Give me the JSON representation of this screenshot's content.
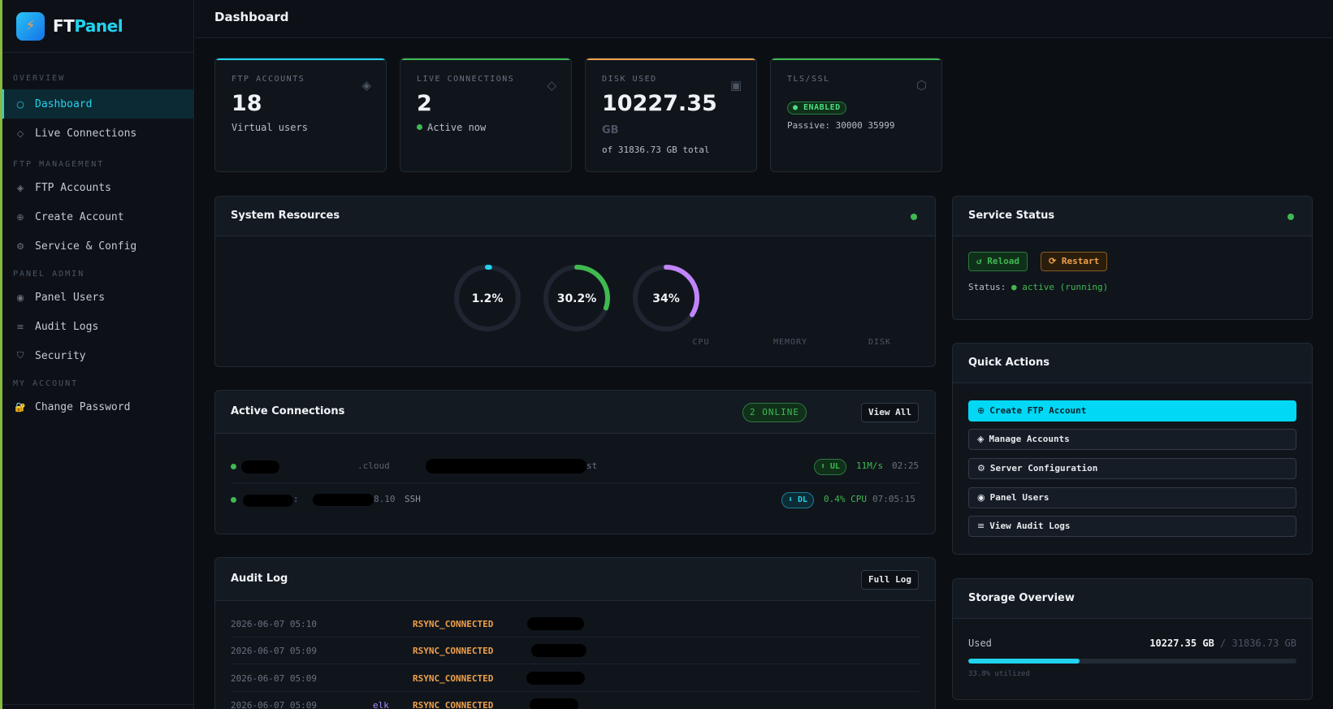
{
  "brand": {
    "logo_glyph": "⚡",
    "name_part1": "FT",
    "name_part2": "Panel"
  },
  "sidebar": {
    "sections": [
      {
        "title": "OVERVIEW",
        "items": [
          {
            "icon": "circle-outline-icon",
            "glyph": "○",
            "label": "Dashboard",
            "active": true
          },
          {
            "icon": "diamond-outline-icon",
            "glyph": "◇",
            "label": "Live Connections"
          }
        ]
      },
      {
        "title": "FTP MANAGEMENT",
        "items": [
          {
            "icon": "diamond-dot-icon",
            "glyph": "◈",
            "label": "FTP Accounts"
          },
          {
            "icon": "plus-circle-icon",
            "glyph": "⊕",
            "label": "Create Account"
          },
          {
            "icon": "gear-icon",
            "glyph": "⚙",
            "label": "Service & Config"
          }
        ]
      },
      {
        "title": "PANEL ADMIN",
        "items": [
          {
            "icon": "user-circle-icon",
            "glyph": "◉",
            "label": "Panel Users"
          },
          {
            "icon": "list-icon",
            "glyph": "≡",
            "label": "Audit Logs"
          },
          {
            "icon": "shield-icon",
            "glyph": "⛉",
            "label": "Security"
          }
        ]
      },
      {
        "title": "MY ACCOUNT",
        "items": [
          {
            "icon": "lock-icon",
            "glyph": "🔐",
            "label": "Change Password"
          }
        ]
      }
    ]
  },
  "header": {
    "title": "Dashboard"
  },
  "stats": {
    "ftp_accounts": {
      "label": "FTP ACCOUNTS",
      "value": "18",
      "sub": "Virtual users",
      "icon_glyph": "◈",
      "accent": "#22d3ee"
    },
    "live_connections": {
      "label": "LIVE CONNECTIONS",
      "value": "2",
      "sub": "Active now",
      "icon_glyph": "◇",
      "accent": "#3fb950"
    },
    "disk_used": {
      "label": "DISK USED",
      "value": "10227.35",
      "unit": "GB",
      "sub": "of 31836.73 GB total",
      "icon_glyph": "▣",
      "accent": "#f0a04b"
    },
    "tls": {
      "label": "TLS/SSL",
      "badge": "● ENABLED",
      "sub": "Passive: 30000 35999",
      "icon_glyph": "⬡",
      "accent": "#3fb950"
    }
  },
  "system_resources": {
    "title": "System Resources",
    "gauges": [
      {
        "label": "CPU",
        "display": "1.2%",
        "percent": 1.2,
        "color": "#22d3ee"
      },
      {
        "label": "MEMORY",
        "display": "30.2%",
        "percent": 30.2,
        "color": "#3fb950"
      },
      {
        "label": "DISK",
        "display": "34%",
        "percent": 34,
        "color": "#c084fc"
      }
    ]
  },
  "active_connections": {
    "title": "Active Connections",
    "online_badge": "2 ONLINE",
    "view_all_label": "View All",
    "rows": [
      {
        "host_suffix": ".cloud",
        "path_suffix": "st",
        "direction": "⬆ UL",
        "rate": "11M/s",
        "time": "02:25"
      },
      {
        "host_suffix": ":",
        "ip_suffix": "8.10",
        "protocol": "SSH",
        "direction": "⬇ DL",
        "rate": "0.4% CPU",
        "time": "07:05:15"
      }
    ]
  },
  "audit_log": {
    "title": "Audit Log",
    "full_log_label": "Full Log",
    "rows": [
      {
        "ts": "2026-06-07 05:10",
        "user": "",
        "action": "RSYNC_CONNECTED"
      },
      {
        "ts": "2026-06-07 05:09",
        "user": "",
        "action": "RSYNC_CONNECTED"
      },
      {
        "ts": "2026-06-07 05:09",
        "user": "",
        "action": "RSYNC_CONNECTED"
      },
      {
        "ts": "2026-06-07 05:09",
        "user": "elk",
        "action": "RSYNC_CONNECTED"
      }
    ]
  },
  "service_status": {
    "title": "Service Status",
    "reload_label": "↺ Reload",
    "restart_label": "⟳ Restart",
    "status_prefix": "Status:",
    "status_value": "● active (running)"
  },
  "quick_actions": {
    "title": "Quick Actions",
    "buttons": [
      {
        "icon": "plus-circle-icon",
        "glyph": "⊕",
        "label": "Create FTP Account",
        "primary": true
      },
      {
        "icon": "diamond-icon",
        "glyph": "◈",
        "label": "Manage Accounts"
      },
      {
        "icon": "gear-icon",
        "glyph": "⚙",
        "label": "Server Configuration"
      },
      {
        "icon": "user-circle-icon",
        "glyph": "◉",
        "label": "Panel Users"
      },
      {
        "icon": "list-icon",
        "glyph": "≡",
        "label": "View Audit Logs"
      }
    ]
  },
  "storage_overview": {
    "title": "Storage Overview",
    "used_label": "Used",
    "used_value": "10227.35 GB",
    "separator": "/",
    "total_value": "31836.73 GB",
    "percent": 33.8,
    "utilized_text": "33.8% utilized"
  }
}
